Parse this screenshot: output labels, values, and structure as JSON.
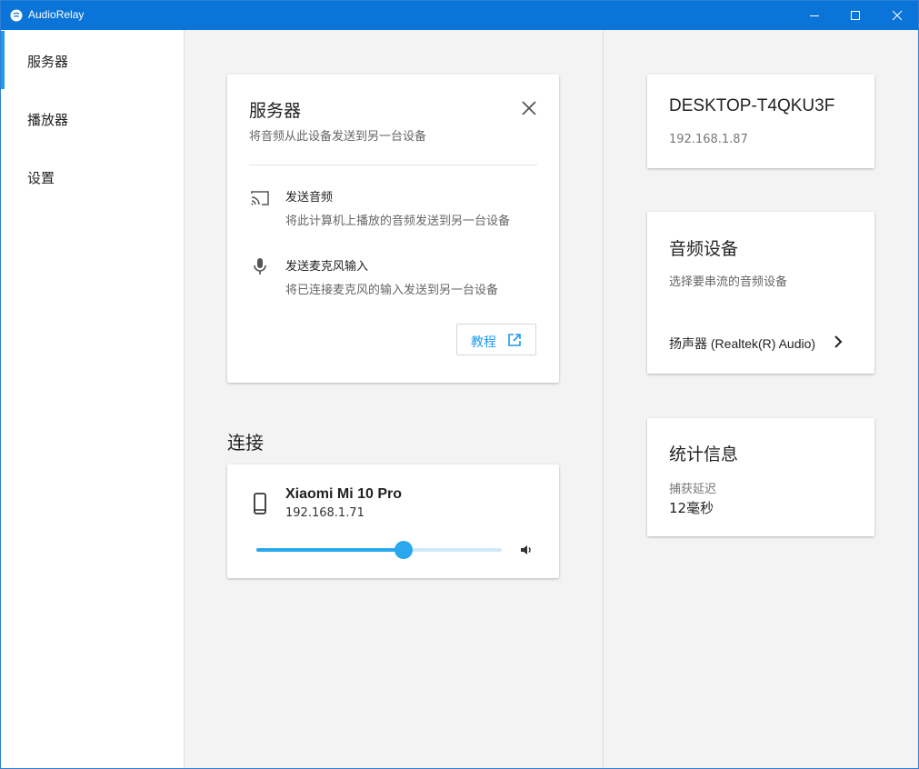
{
  "window": {
    "title": "AudioRelay",
    "accent": "#0a74d8"
  },
  "sidebar": {
    "items": [
      {
        "label": "服务器",
        "active": true
      },
      {
        "label": "播放器",
        "active": false
      },
      {
        "label": "设置",
        "active": false
      }
    ]
  },
  "server_card": {
    "title": "服务器",
    "subtitle": "将音频从此设备发送到另一台设备",
    "features": [
      {
        "icon": "cast-icon",
        "title": "发送音频",
        "description": "将此计算机上播放的音频发送到另一台设备"
      },
      {
        "icon": "microphone-icon",
        "title": "发送麦克风输入",
        "description": "将已连接麦克风的输入发送到另一台设备"
      }
    ],
    "tutorial_label": "教程"
  },
  "connections": {
    "heading": "连接",
    "device": {
      "name": "Xiaomi Mi 10 Pro",
      "ip": "192.168.1.71",
      "volume_fraction": 0.6
    }
  },
  "host": {
    "name": "DESKTOP-T4QKU3F",
    "ip": "192.168.1.87"
  },
  "audio_devices": {
    "title": "音频设备",
    "subtitle": "选择要串流的音频设备",
    "selected": "扬声器 (Realtek(R) Audio)"
  },
  "stats": {
    "title": "统计信息",
    "latency_label": "捕获延迟",
    "latency_value": "12毫秒"
  },
  "colors": {
    "accent": "#1e9bf0",
    "slider": "#29a8ee"
  }
}
